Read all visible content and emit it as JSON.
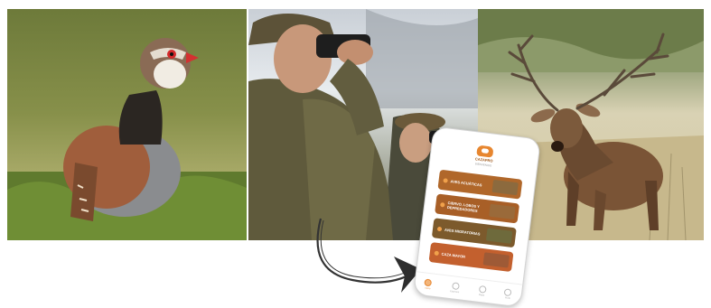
{
  "photos": [
    {
      "name": "red-legged-partridge-photo"
    },
    {
      "name": "hunters-with-binoculars-photo"
    },
    {
      "name": "roaring-red-deer-photo"
    }
  ],
  "app": {
    "name": "CAZAPRO",
    "subtitle": "BIENVENIDO",
    "menu": [
      {
        "label": "AVES ACUÁTICAS"
      },
      {
        "label": "CIERVO, LOBOS Y DEPREDADORES"
      },
      {
        "label": "AVES MIGRATORIAS"
      },
      {
        "label": "CAZA MAYOR"
      }
    ],
    "nav": [
      {
        "label": "Inicio",
        "active": true
      },
      {
        "label": "Especies",
        "active": false
      },
      {
        "label": "Mapa",
        "active": false
      },
      {
        "label": "Perfil",
        "active": false
      }
    ]
  },
  "colors": {
    "accent": "#e7862f",
    "arrow": "#333333"
  }
}
